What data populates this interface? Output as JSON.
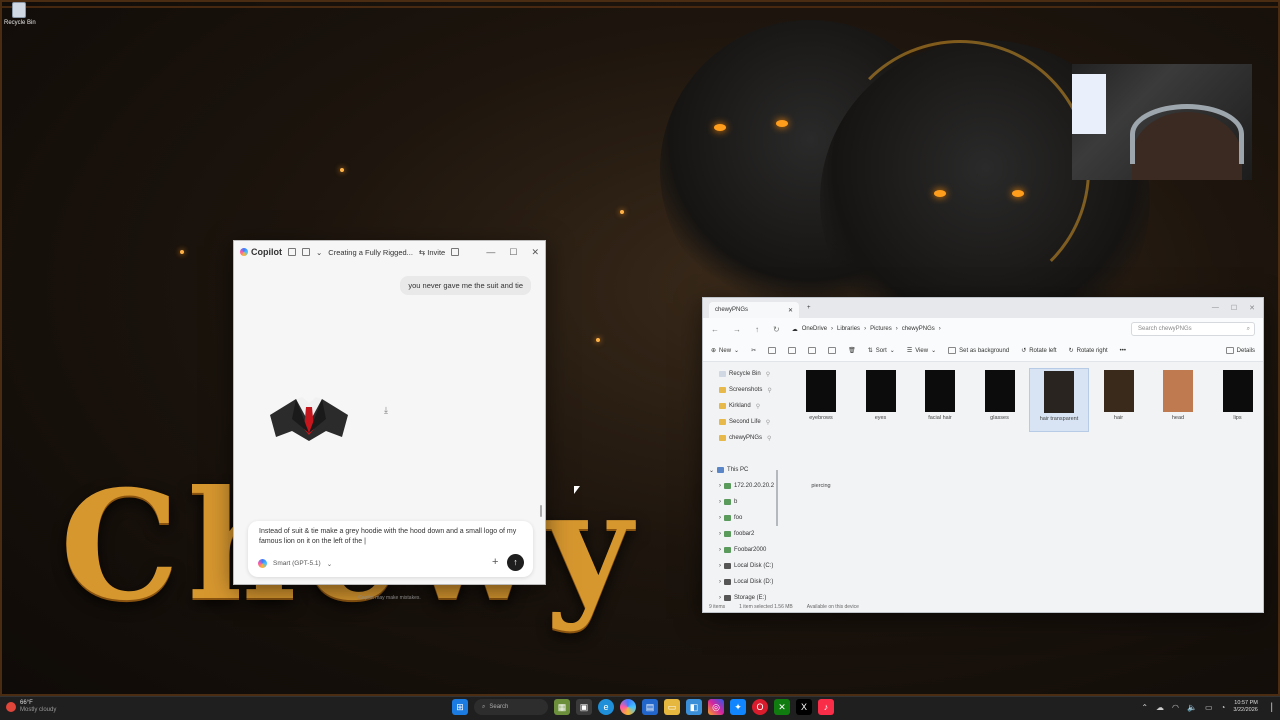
{
  "desktop": {
    "recycle_bin": "Recycle Bin",
    "banner_text": "Chewy Ki"
  },
  "copilot": {
    "app_name": "Copilot",
    "conversation_title": "Creating a Fully Rigged...",
    "invite_label": "Invite",
    "user_message": "you never gave me the suit and tie",
    "prompt_text": "Instead of suit & tie make a grey hoodie with the hood down and a small logo of my famous lion on it on the left of the |",
    "model_label": "Smart (GPT-5.1)",
    "send_icon": "arrow-up",
    "disclaimer": "Copilot may make mistakes."
  },
  "explorer": {
    "tab_title": "chewyPNGs",
    "breadcrumbs": [
      "OneDrive",
      "Libraries",
      "Pictures",
      "chewyPNGs"
    ],
    "search_placeholder": "Search chewyPNGs",
    "toolbar": {
      "new": "New",
      "sort": "Sort",
      "view": "View",
      "set_background": "Set as background",
      "rotate_left": "Rotate left",
      "rotate_right": "Rotate right",
      "more": "•••",
      "details": "Details"
    },
    "nav_pinned": [
      "Recycle Bin",
      "Screenshots",
      "Kirkland",
      "Second Life",
      "chewyPNGs"
    ],
    "nav_this_pc": "This PC",
    "nav_drives": [
      "172.20.20.20.2",
      "b",
      "foo",
      "foobar2",
      "Foobar2000",
      "Local Disk (C:)",
      "Local Disk (D:)",
      "Storage (E:)"
    ],
    "files": [
      {
        "name": "eyebrows",
        "color": "#0c0c0c"
      },
      {
        "name": "eyes",
        "color": "#0c0c0c"
      },
      {
        "name": "facial hair",
        "color": "#0c0c0c"
      },
      {
        "name": "glasses",
        "color": "#0c0c0c"
      },
      {
        "name": "hair transparent",
        "color": "#2a2420",
        "selected": true
      },
      {
        "name": "hair",
        "color": "#3a2a1c"
      },
      {
        "name": "head",
        "color": "#c07a50"
      },
      {
        "name": "lips",
        "color": "#0c0c0c"
      },
      {
        "name": "piercing",
        "color": "#f2f3f5"
      }
    ],
    "status_items": "9 items",
    "status_selected": "1 item selected  1.56 MB",
    "status_available": "Available on this device"
  },
  "taskbar": {
    "weather_temp": "66°F",
    "weather_desc": "Mostly cloudy",
    "search_label": "Search",
    "time": "10:57 PM",
    "date": "3/22/2026"
  }
}
